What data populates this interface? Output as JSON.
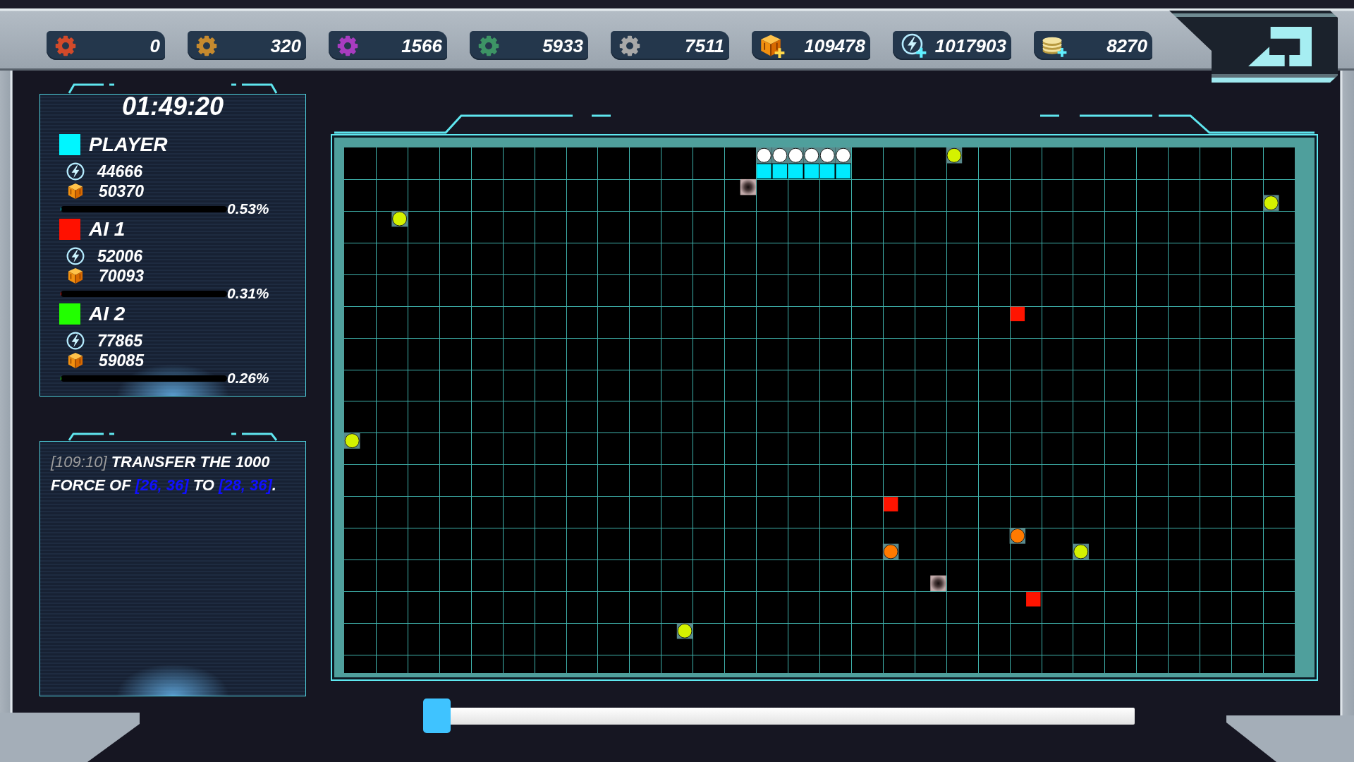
{
  "resources": [
    {
      "kind": "gear",
      "color": "#d24a2a",
      "value": "0"
    },
    {
      "kind": "gear",
      "color": "#c68a2e",
      "value": "320"
    },
    {
      "kind": "gear",
      "color": "#a83cc0",
      "value": "1566"
    },
    {
      "kind": "gear",
      "color": "#3d9465",
      "value": "5933"
    },
    {
      "kind": "gear",
      "color": "#a8a8a8",
      "value": "7511"
    },
    {
      "kind": "cube_plus",
      "value": "109478"
    },
    {
      "kind": "lightning_plus",
      "value": "1017903"
    },
    {
      "kind": "coins_plus",
      "value": "8270"
    }
  ],
  "timer": "01:49:20",
  "players": [
    {
      "name": "PLAYER",
      "color": "#00f6ff",
      "lightning_value": "44666",
      "cube_value": "50370",
      "level": 0.0053,
      "percent": "0.53%"
    },
    {
      "name": "AI 1",
      "color": "#ff1100",
      "lightning_value": "52006",
      "cube_value": "70093",
      "level": 0.0031,
      "percent": "0.31%"
    },
    {
      "name": "AI 2",
      "color": "#22ff00",
      "lightning_value": "77865",
      "cube_value": "59085",
      "level": 0.0026,
      "percent": "0.26%"
    }
  ],
  "log": [
    {
      "segments": [
        {
          "kind": "time",
          "text": "[109:10]"
        },
        {
          "kind": "text",
          "text": " TRANSFER THE 1000 FORCE OF "
        },
        {
          "kind": "coord",
          "text": "[26, 36]"
        },
        {
          "kind": "text",
          "text": " TO "
        },
        {
          "kind": "coord",
          "text": "[28, 36]"
        },
        {
          "kind": "text",
          "text": "."
        }
      ]
    }
  ],
  "board": {
    "tiles": [
      {
        "kind": "orb",
        "color": "#ffffff"
      },
      {
        "kind": "orb",
        "color": "#ffffff"
      },
      {
        "kind": "orb",
        "color": "#ffffff"
      },
      {
        "kind": "orb",
        "color": "#ffffff"
      },
      {
        "kind": "orb",
        "color": "#ffffff"
      },
      {
        "kind": "orb",
        "color": "#ffffff"
      },
      {
        "kind": "orb",
        "color": "#d4f200"
      },
      {
        "kind": "territory",
        "color": "#00eaff"
      },
      {
        "kind": "territory",
        "color": "#00eaff"
      },
      {
        "kind": "territory",
        "color": "#00eaff"
      },
      {
        "kind": "territory",
        "color": "#00eaff"
      },
      {
        "kind": "territory",
        "color": "#00eaff"
      },
      {
        "kind": "territory",
        "color": "#00eaff"
      },
      {
        "kind": "crater"
      },
      {
        "kind": "orb",
        "color": "#d4f200"
      },
      {
        "kind": "orb",
        "color": "#d4f200"
      },
      {
        "kind": "territory",
        "color": "#ff1400"
      },
      {
        "kind": "orb",
        "color": "#d4f200"
      },
      {
        "kind": "territory",
        "color": "#ff1400"
      },
      {
        "kind": "orb",
        "color": "#ff7a00"
      },
      {
        "kind": "orb",
        "color": "#ff7a00"
      },
      {
        "kind": "orb",
        "color": "#d4f200"
      },
      {
        "kind": "crater"
      },
      {
        "kind": "territory",
        "color": "#ff1400"
      },
      {
        "kind": "orb",
        "color": "#d4f200"
      }
    ]
  },
  "timeline": {
    "level": 0
  }
}
